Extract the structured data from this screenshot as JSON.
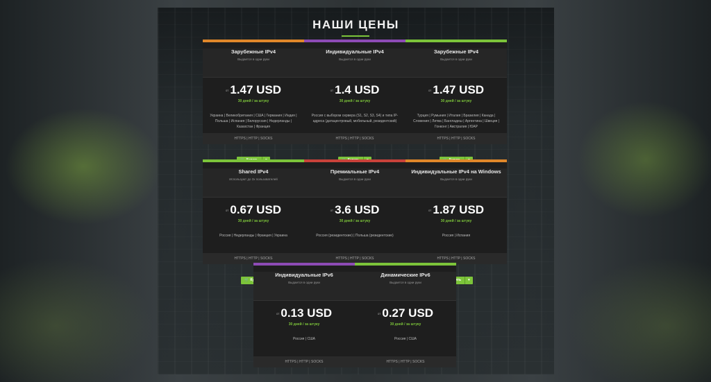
{
  "page": {
    "title": "НАШИ ЦЕНЫ"
  },
  "common": {
    "from": "от",
    "per": "30 дней / за штуку",
    "buy": "Купить",
    "cart_icon": "cart-icon",
    "caret": "▾"
  },
  "cards": [
    {
      "name": "Зарубежные IPv4",
      "sub": "Выдается в одни руки",
      "price": "1.47 USD",
      "geo": "Украина | Великобритания | США | Германия | Индия | Польша | Испания | Белоруссия | Нидерланды | Казахстан | Франция",
      "proto": "HTTPS | HTTP | SOCKS",
      "bar": "#e0872a",
      "caret": true
    },
    {
      "name": "Индивидуальные IPv4",
      "sub": "Выдается в одни руки",
      "price": "1.4 USD",
      "geo": "Россия с выбором сервера (S1, S2, S3, S4) и типа IP-адреса (датацентровый, мобильный, резидентский)",
      "proto": "HTTPS | HTTP | SOCKS",
      "bar": "#8d4bb5",
      "caret": true
    },
    {
      "name": "Зарубежные IPv4",
      "sub": "Выдается в одни руки",
      "price": "1.47 USD",
      "geo": "Турция | Румыния | Италия | Бразилия | Канада | Словения | Литва | Бангладеш | Аргентина | Швеция | Гонконг | Австралия | ЮАР",
      "proto": "HTTPS | HTTP | SOCKS",
      "bar": "#7cc43a",
      "caret": true
    },
    {
      "name": "Shared IPv4",
      "sub": "Используют до 3х пользователей",
      "price": "0.67 USD",
      "geo": "Россия | Нидерланды | Франция | Украина",
      "proto": "HTTPS | HTTP | SOCKS",
      "bar": "#7cc43a",
      "caret": false
    },
    {
      "name": "Премиальные IPv4",
      "sub": "Выдается в одни руки",
      "price": "3.6 USD",
      "geo": "Россия (резидентские) | Польша (резидентские)",
      "proto": "HTTPS | HTTP | SOCKS",
      "bar": "#c9423a",
      "caret": true
    },
    {
      "name": "Индивидуальные IPv4 на Windows",
      "sub": "Выдается в одни руки",
      "price": "1.87 USD",
      "geo": "Россия | Испания",
      "proto": "HTTPS | HTTP | SOCKS",
      "bar": "#e0872a",
      "caret": true
    },
    {
      "name": "Индивидуальные IPv6",
      "sub": "Выдается в одни руки",
      "price": "0.13 USD",
      "geo": "Россия | США",
      "proto": "HTTPS | HTTP | SOCKS",
      "bar": "#8d4bb5",
      "caret": true
    },
    {
      "name": "Динамические IPv6",
      "sub": "Выдается в одни руки",
      "price": "0.27 USD",
      "geo": "Россия | США",
      "proto": "HTTPS | HTTP | SOCKS",
      "bar": "#7cc43a",
      "caret": true
    }
  ]
}
